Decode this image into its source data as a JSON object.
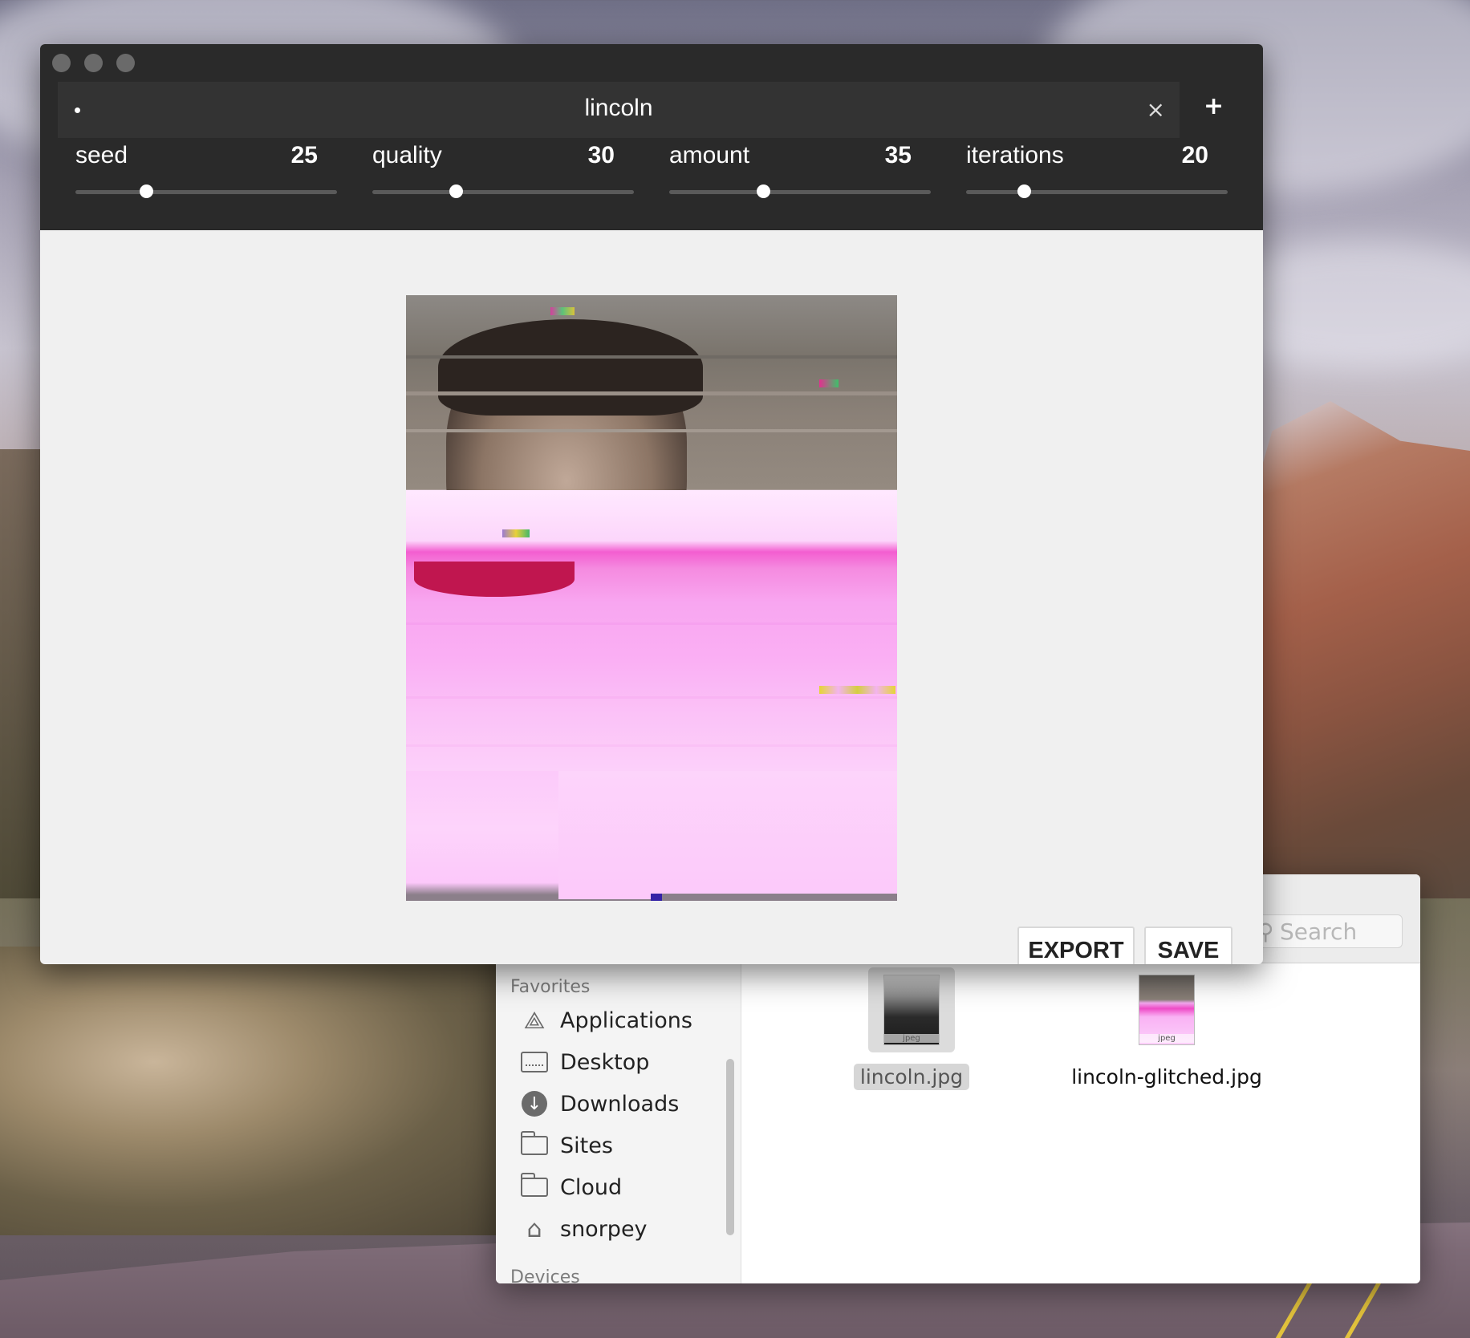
{
  "app": {
    "tab_title": "lincoln",
    "tab_close": "×",
    "tab_add": "+",
    "controls": [
      {
        "label": "seed",
        "value": "25",
        "fraction": 0.27
      },
      {
        "label": "quality",
        "value": "30",
        "fraction": 0.32
      },
      {
        "label": "amount",
        "value": "35",
        "fraction": 0.36
      },
      {
        "label": "iterations",
        "value": "20",
        "fraction": 0.22
      }
    ],
    "buttons": {
      "export": "EXPORT",
      "save": "SAVE"
    }
  },
  "finder": {
    "search_placeholder": "Search",
    "favorites_heading": "Favorites",
    "devices_heading": "Devices",
    "sidebar_items": [
      {
        "label": "Applications",
        "icon": "applications-icon"
      },
      {
        "label": "Desktop",
        "icon": "desktop-icon"
      },
      {
        "label": "Downloads",
        "icon": "downloads-icon"
      },
      {
        "label": "Sites",
        "icon": "folder-icon"
      },
      {
        "label": "Cloud",
        "icon": "folder-icon"
      },
      {
        "label": "snorpey",
        "icon": "home-icon"
      }
    ],
    "files": [
      {
        "name": "lincoln.jpg",
        "type": "jpeg",
        "selected": true
      },
      {
        "name": "lincoln-glitched.jpg",
        "type": "jpeg",
        "selected": false
      }
    ]
  }
}
